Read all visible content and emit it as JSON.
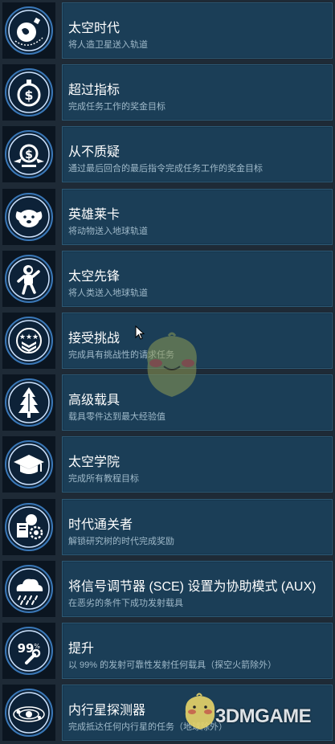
{
  "achievements": [
    {
      "title": "太空时代",
      "desc": "将人造卫星送入轨道",
      "icon": "satellite-earth-icon"
    },
    {
      "title": "超过指标",
      "desc": "完成任务工作的奖金目标",
      "icon": "dollar-stopwatch-icon"
    },
    {
      "title": "从不质疑",
      "desc": "通过最后回合的最后指令完成任务工作的奖金目标",
      "icon": "dollar-wings-icon"
    },
    {
      "title": "英雄莱卡",
      "desc": "将动物送入地球轨道",
      "icon": "dog-icon"
    },
    {
      "title": "太空先锋",
      "desc": "将人类送入地球轨道",
      "icon": "astronaut-icon"
    },
    {
      "title": "接受挑战",
      "desc": "完成具有挑战性的请求任务",
      "icon": "rank-stars-icon"
    },
    {
      "title": "高级载具",
      "desc": "载具零件达到最大经验值",
      "icon": "rocket-tree-icon"
    },
    {
      "title": "太空学院",
      "desc": "完成所有教程目标",
      "icon": "graduation-cap-icon"
    },
    {
      "title": "时代通关者",
      "desc": "解锁研究树的时代完成奖励",
      "icon": "research-tree-icon"
    },
    {
      "title": "将信号调节器 (SCE) 设置为协助模式 (AUX)",
      "desc": "在恶劣的条件下成功发射载具",
      "icon": "storm-cloud-icon"
    },
    {
      "title": "提升",
      "desc": "以 99% 的发射可靠性发射任何载具（探空火箭除外）",
      "icon": "wrench-99-icon"
    },
    {
      "title": "内行星探测器",
      "desc": "完成抵达任何内行星的任务（地球除外）",
      "icon": "solar-system-icon"
    }
  ],
  "watermark": {
    "text": "3DMGAME"
  },
  "colors": {
    "panel": "#1b3e57",
    "badge": "#0b1520",
    "title": "#ffffff",
    "desc": "#9fb9c9"
  }
}
